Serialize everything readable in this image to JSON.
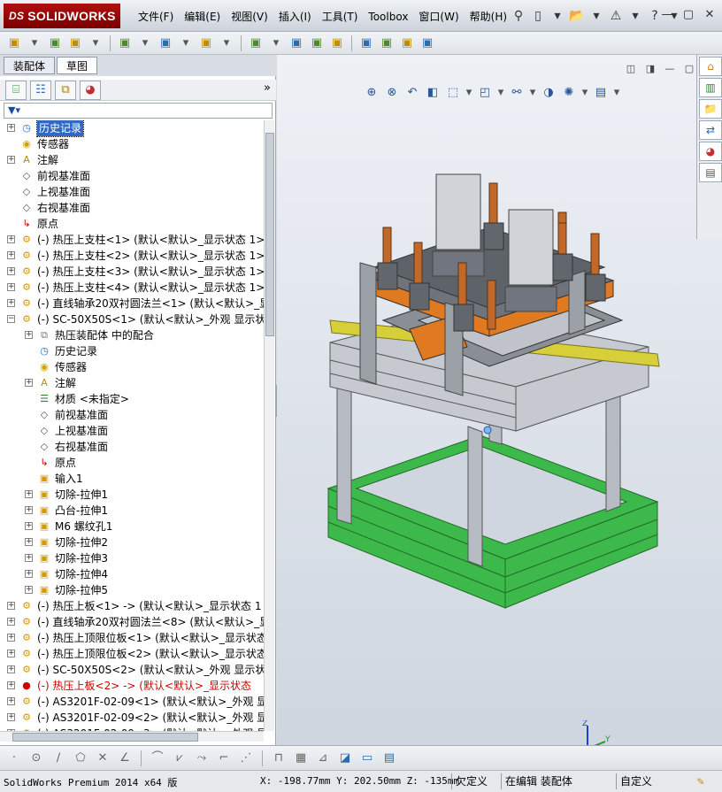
{
  "app": {
    "title_logo": "SOLIDWORKS",
    "logo_mark": "DS"
  },
  "menus": [
    "文件(F)",
    "编辑(E)",
    "视图(V)",
    "插入(I)",
    "工具(T)",
    "Toolbox",
    "窗口(W)",
    "帮助(H)"
  ],
  "title_icons": [
    {
      "icon": "pushpin-icon",
      "glyph": "⚲"
    },
    {
      "icon": "new-document-icon",
      "glyph": "▯"
    },
    {
      "icon": "dropdown-icon",
      "glyph": "▾"
    },
    {
      "icon": "open-folder-icon",
      "glyph": "📂"
    },
    {
      "icon": "dropdown-icon",
      "glyph": "▾"
    },
    {
      "icon": "rebuild-warning-icon",
      "glyph": "⚠"
    },
    {
      "icon": "dropdown-icon",
      "glyph": "▾"
    },
    {
      "icon": "help-icon",
      "glyph": "?"
    },
    {
      "icon": "dropdown-icon",
      "glyph": "▾"
    }
  ],
  "window_controls": [
    {
      "icon": "minimize-icon",
      "glyph": "—"
    },
    {
      "icon": "restore-icon",
      "glyph": "▢"
    },
    {
      "icon": "close-icon",
      "glyph": "✕"
    }
  ],
  "command_toolbar": [
    "assembly-feature-icon",
    "dropdown-icon",
    "paperclip-icon",
    "smart-mates-icon",
    "dropdown-icon",
    "insert-component-icon",
    "dropdown-icon",
    "explode-view-icon",
    "dropdown-icon",
    "mate-icon",
    "dropdown-icon",
    "linear-pattern-icon",
    "dropdown-icon",
    "move-component-icon",
    "rotate-component-icon",
    "show-hidden-icon",
    "assembly-features-icon",
    "reference-geometry-icon",
    "new-motion-study-icon",
    "bill-of-materials-icon"
  ],
  "tabs": [
    "装配体",
    "草图"
  ],
  "feature_manager_icons": [
    "feature-tree-icon",
    "property-manager-icon",
    "configuration-manager-icon",
    "display-manager-icon"
  ],
  "filter_glyph": "▼▾",
  "tree": [
    {
      "level": 0,
      "expander": "+",
      "icon": "history-icon",
      "glyph": "◷",
      "color": "#1e6fc9",
      "label": "历史记录",
      "selected": true
    },
    {
      "level": 0,
      "expander": "",
      "icon": "sensor-icon",
      "glyph": "◉",
      "color": "#d4a000",
      "label": "传感器"
    },
    {
      "level": 0,
      "expander": "+",
      "icon": "annotation-icon",
      "glyph": "A",
      "color": "#c08a00",
      "label": "注解"
    },
    {
      "level": 0,
      "expander": "",
      "icon": "plane-icon",
      "glyph": "◇",
      "color": "#555",
      "label": "前视基准面"
    },
    {
      "level": 0,
      "expander": "",
      "icon": "plane-icon",
      "glyph": "◇",
      "color": "#555",
      "label": "上视基准面"
    },
    {
      "level": 0,
      "expander": "",
      "icon": "plane-icon",
      "glyph": "◇",
      "color": "#555",
      "label": "右视基准面"
    },
    {
      "level": 0,
      "expander": "",
      "icon": "origin-icon",
      "glyph": "↳",
      "color": "#c00",
      "label": "原点"
    },
    {
      "level": 0,
      "expander": "+",
      "icon": "subassembly-icon",
      "glyph": "⚙",
      "color": "#d49a00",
      "label": "(-) 热压上支柱<1> (默认<默认>_显示状态 1>"
    },
    {
      "level": 0,
      "expander": "+",
      "icon": "subassembly-icon",
      "glyph": "⚙",
      "color": "#d49a00",
      "label": "(-) 热压上支柱<2> (默认<默认>_显示状态 1>"
    },
    {
      "level": 0,
      "expander": "+",
      "icon": "subassembly-icon",
      "glyph": "⚙",
      "color": "#d49a00",
      "label": "(-) 热压上支柱<3> (默认<默认>_显示状态 1>"
    },
    {
      "level": 0,
      "expander": "+",
      "icon": "subassembly-icon",
      "glyph": "⚙",
      "color": "#d49a00",
      "label": "(-) 热压上支柱<4> (默认<默认>_显示状态 1>"
    },
    {
      "level": 0,
      "expander": "+",
      "icon": "subassembly-icon",
      "glyph": "⚙",
      "color": "#d49a00",
      "label": "(-) 直线轴承20双衬圆法兰<1> (默认<默认>_显"
    },
    {
      "level": 0,
      "expander": "−",
      "icon": "part-icon",
      "glyph": "⚙",
      "color": "#d49a00",
      "label": "(-) SC-50X50S<1> (默认<默认>_外观 显示状态"
    },
    {
      "level": 1,
      "expander": "+",
      "icon": "mates-icon",
      "glyph": "⧉",
      "color": "#777",
      "label": "热压装配体 中的配合"
    },
    {
      "level": 1,
      "expander": "",
      "icon": "history-icon",
      "glyph": "◷",
      "color": "#1e6fc9",
      "label": "历史记录"
    },
    {
      "level": 1,
      "expander": "",
      "icon": "sensor-icon",
      "glyph": "◉",
      "color": "#d4a000",
      "label": "传感器"
    },
    {
      "level": 1,
      "expander": "+",
      "icon": "annotation-icon",
      "glyph": "A",
      "color": "#c08a00",
      "label": "注解"
    },
    {
      "level": 1,
      "expander": "",
      "icon": "material-icon",
      "glyph": "☰",
      "color": "#2f7d2f",
      "label": "材质 <未指定>"
    },
    {
      "level": 1,
      "expander": "",
      "icon": "plane-icon",
      "glyph": "◇",
      "color": "#555",
      "label": "前视基准面"
    },
    {
      "level": 1,
      "expander": "",
      "icon": "plane-icon",
      "glyph": "◇",
      "color": "#555",
      "label": "上视基准面"
    },
    {
      "level": 1,
      "expander": "",
      "icon": "plane-icon",
      "glyph": "◇",
      "color": "#555",
      "label": "右视基准面"
    },
    {
      "level": 1,
      "expander": "",
      "icon": "origin-icon",
      "glyph": "↳",
      "color": "#c00",
      "label": "原点"
    },
    {
      "level": 1,
      "expander": "",
      "icon": "import-feature-icon",
      "glyph": "▣",
      "color": "#d49a00",
      "label": "输入1"
    },
    {
      "level": 1,
      "expander": "+",
      "icon": "cut-extrude-icon",
      "glyph": "▣",
      "color": "#d49a00",
      "label": "切除-拉伸1"
    },
    {
      "level": 1,
      "expander": "+",
      "icon": "boss-extrude-icon",
      "glyph": "▣",
      "color": "#d49a00",
      "label": "凸台-拉伸1"
    },
    {
      "level": 1,
      "expander": "+",
      "icon": "hole-wizard-icon",
      "glyph": "▣",
      "color": "#d49a00",
      "label": "M6 螺纹孔1"
    },
    {
      "level": 1,
      "expander": "+",
      "icon": "cut-extrude-icon",
      "glyph": "▣",
      "color": "#d49a00",
      "label": "切除-拉伸2"
    },
    {
      "level": 1,
      "expander": "+",
      "icon": "cut-extrude-icon",
      "glyph": "▣",
      "color": "#d49a00",
      "label": "切除-拉伸3"
    },
    {
      "level": 1,
      "expander": "+",
      "icon": "cut-extrude-icon",
      "glyph": "▣",
      "color": "#d49a00",
      "label": "切除-拉伸4"
    },
    {
      "level": 1,
      "expander": "+",
      "icon": "cut-extrude-icon",
      "glyph": "▣",
      "color": "#d49a00",
      "label": "切除-拉伸5"
    },
    {
      "level": 0,
      "expander": "+",
      "icon": "subassembly-icon",
      "glyph": "⚙",
      "color": "#d49a00",
      "label": "(-) 热压上板<1> -> (默认<默认>_显示状态 1"
    },
    {
      "level": 0,
      "expander": "+",
      "icon": "subassembly-icon",
      "glyph": "⚙",
      "color": "#d49a00",
      "label": "(-) 直线轴承20双衬圆法兰<8> (默认<默认>_显"
    },
    {
      "level": 0,
      "expander": "+",
      "icon": "subassembly-icon",
      "glyph": "⚙",
      "color": "#d49a00",
      "label": "(-) 热压上顶限位板<1> (默认<默认>_显示状态"
    },
    {
      "level": 0,
      "expander": "+",
      "icon": "subassembly-icon",
      "glyph": "⚙",
      "color": "#d49a00",
      "label": "(-) 热压上顶限位板<2> (默认<默认>_显示状态"
    },
    {
      "level": 0,
      "expander": "+",
      "icon": "subassembly-icon",
      "glyph": "⚙",
      "color": "#d49a00",
      "label": "(-) SC-50X50S<2> (默认<默认>_外观 显示状态"
    },
    {
      "level": 0,
      "expander": "+",
      "icon": "error-icon",
      "glyph": "●",
      "color": "#c00",
      "label": "(-) 热压上板<2> -> (默认<默认>_显示状态",
      "error": true
    },
    {
      "level": 0,
      "expander": "+",
      "icon": "subassembly-icon",
      "glyph": "⚙",
      "color": "#d49a00",
      "label": "(-) AS3201F-02-09<1> (默认<默认>_外观 显示"
    },
    {
      "level": 0,
      "expander": "+",
      "icon": "subassembly-icon",
      "glyph": "⚙",
      "color": "#d49a00",
      "label": "(-) AS3201F-02-09<2> (默认<默认>_外观 显示"
    },
    {
      "level": 0,
      "expander": "+",
      "icon": "subassembly-icon",
      "glyph": "⚙",
      "color": "#d49a00",
      "label": "(-) AS3201F-02-09<3> (默认<默认>_外观 显示"
    }
  ],
  "view_toolbar": [
    {
      "icon": "zoom-to-fit-icon",
      "glyph": "⊕"
    },
    {
      "icon": "zoom-to-area-icon",
      "glyph": "⊗"
    },
    {
      "icon": "previous-view-icon",
      "glyph": "↶"
    },
    {
      "icon": "section-view-icon",
      "glyph": "◧"
    },
    {
      "icon": "view-orientation-icon",
      "glyph": "⬚"
    },
    {
      "icon": "dropdown-icon",
      "glyph": "▾"
    },
    {
      "icon": "display-style-icon",
      "glyph": "◰"
    },
    {
      "icon": "dropdown-icon",
      "glyph": "▾"
    },
    {
      "icon": "hide-show-items-icon",
      "glyph": "⚯"
    },
    {
      "icon": "dropdown-icon",
      "glyph": "▾"
    },
    {
      "icon": "edit-appearance-icon",
      "glyph": "◑"
    },
    {
      "icon": "apply-scene-icon",
      "glyph": "✺"
    },
    {
      "icon": "dropdown-icon",
      "glyph": "▾"
    },
    {
      "icon": "view-settings-icon",
      "glyph": "▤"
    },
    {
      "icon": "dropdown-icon",
      "glyph": "▾"
    }
  ],
  "viewport_controls": [
    "◫",
    "◨",
    "—",
    "▢",
    "✕"
  ],
  "task_pane": [
    {
      "icon": "solidworks-resources-icon",
      "glyph": "⌂"
    },
    {
      "icon": "design-library-icon",
      "glyph": "▥"
    },
    {
      "icon": "file-explorer-icon",
      "glyph": "📁"
    },
    {
      "icon": "view-palette-icon",
      "glyph": "⇄"
    },
    {
      "icon": "appearances-icon",
      "glyph": "◕"
    },
    {
      "icon": "custom-properties-icon",
      "glyph": "▤"
    }
  ],
  "triad": {
    "z": "Z",
    "y": "Y",
    "x": "X"
  },
  "bottom_toolbar": [
    "·",
    "⊙",
    "∕",
    "⬠",
    "✕",
    "∠",
    "|",
    "⌒",
    "⩗",
    "⤳",
    "⌐",
    "⋰",
    "|",
    "⊓",
    "▦",
    "⊿",
    "◪",
    "▭",
    "▤"
  ],
  "status": {
    "product": "SolidWorks Premium 2014 x64 版",
    "coords": "X: -198.77mm Y: 202.50mm Z: -135mm",
    "definition": "欠定义",
    "mode": "在编辑 装配体",
    "units": "自定义"
  },
  "colors": {
    "accent": "#316ac5",
    "frame_green": "#3db84a",
    "plate_orange": "#e07a20",
    "error_red": "#d00000"
  }
}
